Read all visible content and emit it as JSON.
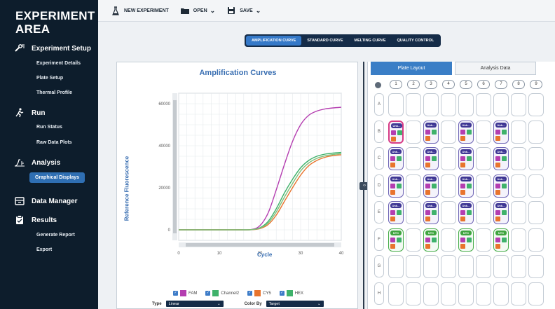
{
  "sidebar": {
    "title": "EXPERIMENT AREA",
    "sections": [
      {
        "label": "Experiment Setup",
        "icon": "wrench-icon",
        "items": [
          "Experiment Details",
          "Plate Setup",
          "Thermal Profile"
        ]
      },
      {
        "label": "Run",
        "icon": "runner-icon",
        "items": [
          "Run Status",
          "Raw Data Plots"
        ]
      },
      {
        "label": "Analysis",
        "icon": "analysis-icon",
        "items": [
          "Graphical Displays"
        ]
      },
      {
        "label": "Data Manager",
        "icon": "data-manager-icon",
        "items": []
      },
      {
        "label": "Results",
        "icon": "results-icon",
        "items": [
          "Generate Report",
          "Export"
        ]
      }
    ],
    "active_item": "Graphical Displays"
  },
  "toolbar": {
    "new_label": "NEW EXPERIMENT",
    "open_label": "OPEN",
    "save_label": "SAVE"
  },
  "view_tabs": [
    "AMPLIFICATION CURVE",
    "STANDARD CURVE",
    "MELTING CURVE",
    "QUALITY CONTROL"
  ],
  "active_view": "AMPLIFICATION CURVE",
  "chart_data": {
    "type": "line",
    "title": "Amplification Curves",
    "xlabel": "Cycle",
    "ylabel": "Reference Fluorescence",
    "xlim": [
      0,
      40
    ],
    "ylim": [
      -5000,
      65000
    ],
    "xticks": [
      0,
      10,
      20,
      30,
      40
    ],
    "yticks": [
      0,
      20000,
      40000,
      60000
    ],
    "grid": true,
    "x": [
      0,
      5,
      10,
      15,
      18,
      20,
      22,
      24,
      26,
      28,
      30,
      32,
      34,
      36,
      38,
      40
    ],
    "series": [
      {
        "name": "FAM",
        "color": "#b43db0",
        "values": [
          0,
          0,
          0,
          0,
          200,
          2000,
          8000,
          19000,
          31000,
          42000,
          50000,
          54500,
          56500,
          57500,
          58000,
          58300
        ]
      },
      {
        "name": "Channel2",
        "color": "#3fb26b",
        "values": [
          0,
          0,
          0,
          0,
          100,
          1000,
          4000,
          10000,
          17500,
          24000,
          29500,
          33000,
          35000,
          36000,
          36500,
          36800
        ]
      },
      {
        "name": "CY5",
        "color": "#e8742d",
        "values": [
          0,
          0,
          0,
          0,
          50,
          600,
          2500,
          7000,
          13500,
          20000,
          26000,
          30500,
          33000,
          34500,
          35300,
          35700
        ]
      },
      {
        "name": "HEX",
        "color": "#7fbf7a",
        "values": [
          0,
          0,
          0,
          0,
          80,
          800,
          3200,
          8500,
          15500,
          22000,
          28000,
          31800,
          34000,
          35200,
          35800,
          36200
        ]
      }
    ]
  },
  "legend": [
    {
      "label": "FAM",
      "color": "#b43db0"
    },
    {
      "label": "Channel2",
      "color": "#3fb26b"
    },
    {
      "label": "CY5",
      "color": "#e8742d"
    },
    {
      "label": "HEX",
      "color": "#3fb26b"
    }
  ],
  "controls": {
    "type_label": "Type",
    "type_value": "Linear",
    "color_by_label": "Color By",
    "color_by_value": "Target"
  },
  "plate_tabs": [
    "Plate Layout",
    "Analysis Data"
  ],
  "active_plate_tab": "Plate Layout",
  "plate": {
    "columns": [
      "1",
      "2",
      "3",
      "4",
      "5",
      "6",
      "7",
      "8",
      "9"
    ],
    "rows": [
      "A",
      "B",
      "C",
      "D",
      "E",
      "F",
      "G",
      "H"
    ],
    "sample_label": "Unk...",
    "ntc_label": "NTC",
    "dye_colors": [
      "#b43db0",
      "#3fb26b",
      "#e8742d"
    ]
  }
}
